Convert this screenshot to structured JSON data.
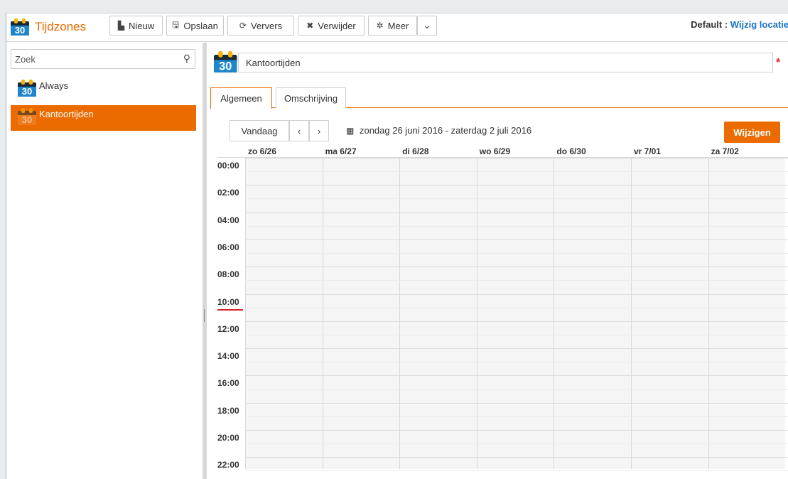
{
  "app": {
    "title": "Tijdzones",
    "icon_day": "30"
  },
  "toolbar": {
    "new_label": "Nieuw",
    "save_label": "Opslaan",
    "refresh_label": "Ververs",
    "delete_label": "Verwijder",
    "more_label": "Meer",
    "location_prefix": "Default :",
    "location_link": "Wijzig locatie"
  },
  "sidebar": {
    "search_placeholder": "Zoek",
    "items": [
      {
        "label": "Always",
        "active": false
      },
      {
        "label": "Kantoortijden",
        "active": true
      }
    ]
  },
  "detail": {
    "name_value": "Kantoortijden",
    "required_mark": "*",
    "tabs": [
      {
        "label": "Algemeen",
        "active": true
      },
      {
        "label": "Omschrijving",
        "active": false
      }
    ],
    "calendar": {
      "today_label": "Vandaag",
      "prev_label": "‹",
      "next_label": "›",
      "range_label": "zondag 26 juni 2016 - zaterdag 2 juli 2016",
      "edit_label": "Wijzigen",
      "days": [
        "zo 6/26",
        "ma 6/27",
        "di 6/28",
        "wo 6/29",
        "do 6/30",
        "vr 7/01",
        "za 7/02"
      ],
      "times": [
        "00:00",
        "02:00",
        "04:00",
        "06:00",
        "08:00",
        "10:00",
        "12:00",
        "14:00",
        "16:00",
        "18:00",
        "20:00",
        "22:00"
      ]
    }
  },
  "colors": {
    "accent": "#ec6b00",
    "link": "#1a73c8",
    "required": "#d9232d",
    "icon_blue": "#1f86c8"
  }
}
